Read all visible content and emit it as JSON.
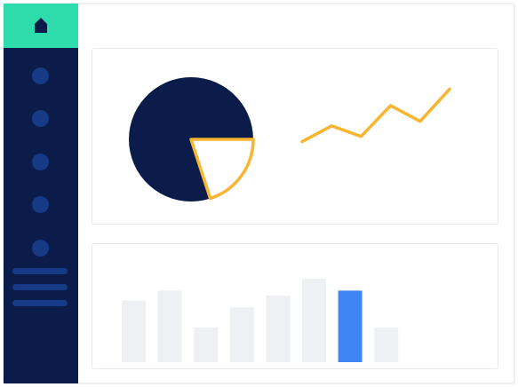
{
  "theme": {
    "sidebar_bg": "#0b1c4a",
    "home_tile_bg": "#2edbab",
    "home_icon_color": "#0b1c4a",
    "nav_item_color": "#173a86",
    "accent_line": "#f8b52f",
    "bar_muted": "#eef0f4",
    "bar_highlight": "#3f86f4"
  },
  "sidebar": {
    "home_icon": "home-icon",
    "nav_dot_count": 5,
    "nav_line_count": 3
  },
  "chart_data": [
    {
      "type": "pie",
      "values": [
        80,
        20
      ],
      "highlight_index": 1,
      "colors": [
        "#0b1c4a",
        "#ffffff"
      ],
      "highlight_outline": "#f8b52f"
    },
    {
      "type": "line",
      "values": [
        0.1,
        0.34,
        0.18,
        0.65,
        0.41,
        0.9
      ],
      "ylim": [
        0,
        1
      ],
      "grid": false,
      "color": "#f8b52f"
    },
    {
      "type": "bar",
      "values": [
        0.62,
        0.72,
        0.35,
        0.55,
        0.67,
        0.84,
        0.72,
        0.35
      ],
      "ylim": [
        0,
        1
      ],
      "highlight_index": 6,
      "grid": false
    }
  ]
}
